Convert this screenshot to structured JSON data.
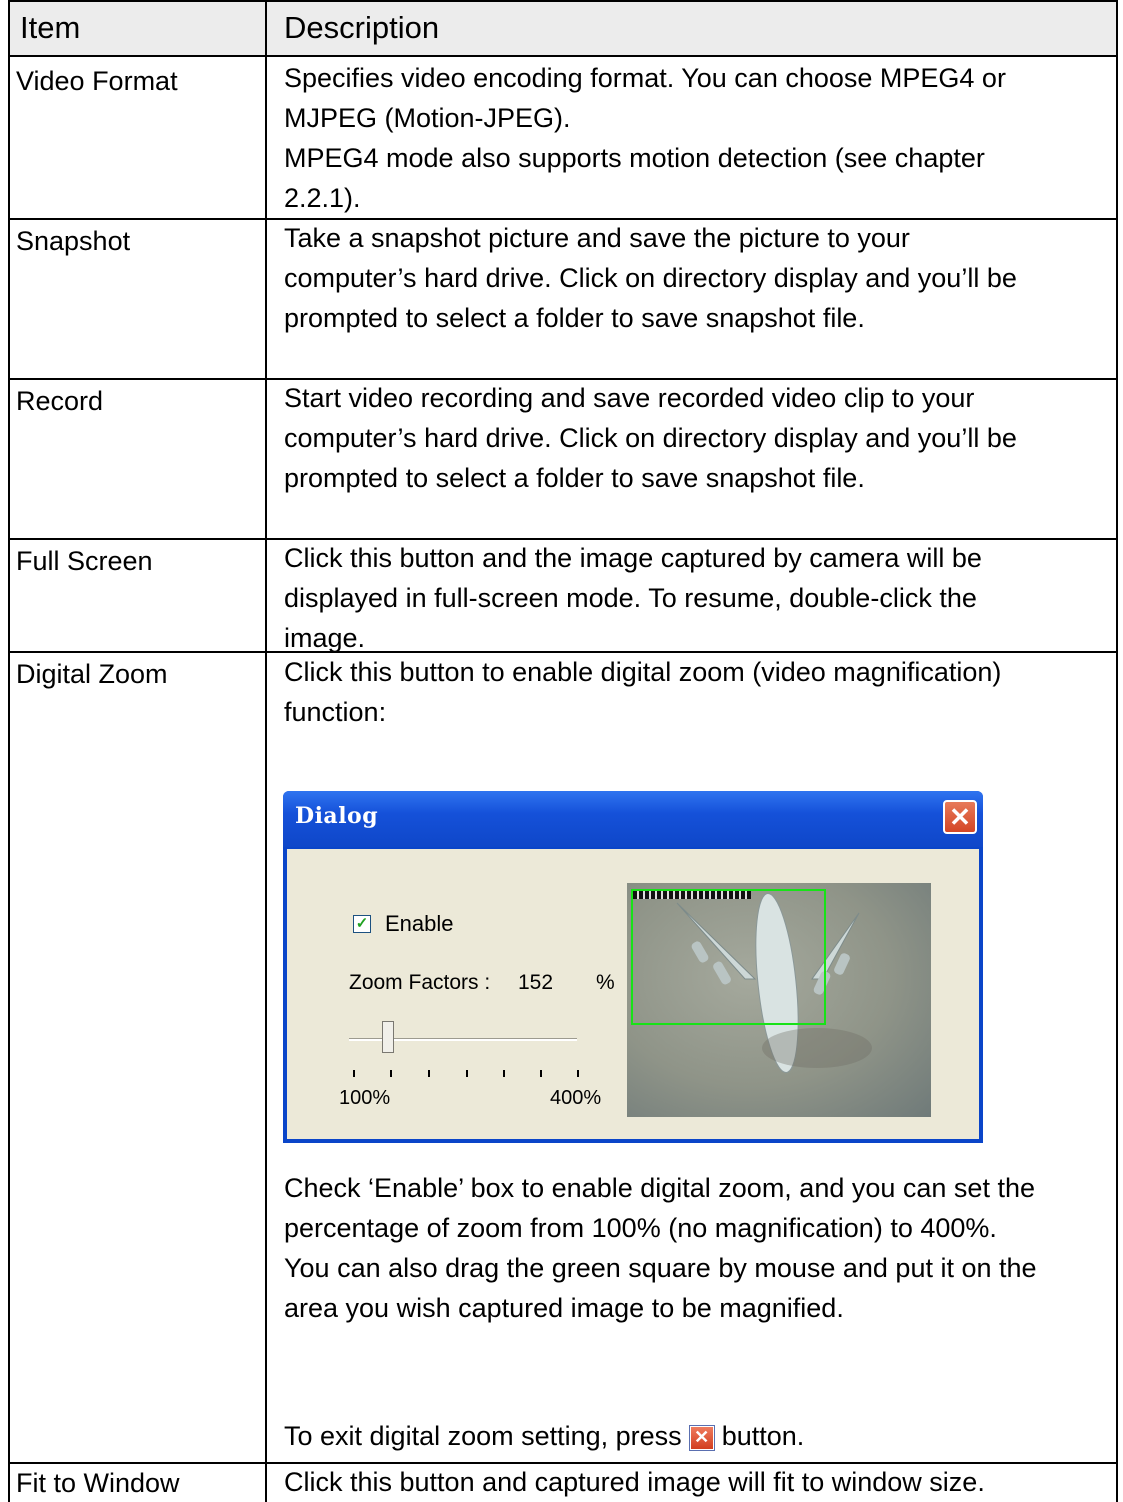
{
  "header": {
    "item": "Item",
    "description": "Description"
  },
  "rows": [
    {
      "item": "Video Format",
      "lines": [
        "Specifies video encoding format. You can choose MPEG4 or",
        "MJPEG (Motion-JPEG).",
        "MPEG4 mode also supports motion detection (see chapter",
        "2.2.1)."
      ]
    },
    {
      "item": "Snapshot",
      "lines": [
        "Take a snapshot picture and save the picture to your",
        "computer’s hard drive. Click on directory display and you’ll be",
        "prompted to select a folder to save snapshot file."
      ]
    },
    {
      "item": "Record",
      "lines": [
        "Start video recording and save recorded video clip to your",
        "computer’s hard drive. Click on directory display and you’ll be",
        "prompted to select a folder to save snapshot file."
      ]
    },
    {
      "item": "Full Screen",
      "lines": [
        "Click this button and the image captured by camera will be",
        "displayed in full-screen mode. To resume, double-click the",
        "image."
      ]
    },
    {
      "item": "Digital Zoom",
      "lines_top": [
        "Click this button to enable digital zoom (video magnification)",
        "function:"
      ],
      "lines_bottom": [
        "Check ‘Enable’ box to enable digital zoom, and you can set the",
        "percentage of zoom from 100% (no magnification) to 400%.",
        "You can also drag the green square by mouse and put it on the",
        "area you wish captured image to be magnified."
      ],
      "exit_before": "To exit digital zoom setting, press",
      "exit_after": "button."
    },
    {
      "item": "Fit to Window",
      "lines": [
        "Click this button and captured image will fit to window size."
      ]
    }
  ],
  "dialog": {
    "title": "Dialog",
    "enable_label": "Enable",
    "enable_checked": true,
    "zoom_label": "Zoom Factors :",
    "zoom_value": "152",
    "zoom_unit": "%",
    "slider_min": "100%",
    "slider_max": "400%",
    "slider_level": 0.17
  }
}
